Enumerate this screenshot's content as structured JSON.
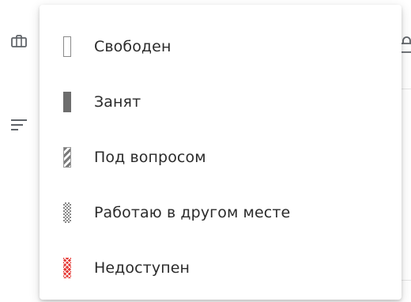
{
  "menu": {
    "items": [
      {
        "label": "Свободен",
        "status": "free",
        "icon": "free-swatch-icon"
      },
      {
        "label": "Занят",
        "status": "busy",
        "icon": "busy-swatch-icon"
      },
      {
        "label": "Под вопросом",
        "status": "tentative",
        "icon": "tentative-swatch-icon"
      },
      {
        "label": "Работаю в другом месте",
        "status": "working-elsewhere",
        "icon": "working-elsewhere-swatch-icon"
      },
      {
        "label": "Недоступен",
        "status": "unavailable",
        "icon": "unavailable-swatch-icon"
      }
    ]
  },
  "colors": {
    "busy": "#6d6d6d",
    "unavailable": "#e53935",
    "text": "#2b2b2b"
  },
  "background": {
    "icons": [
      "briefcase-icon",
      "filter-icon",
      "lock-icon"
    ]
  }
}
